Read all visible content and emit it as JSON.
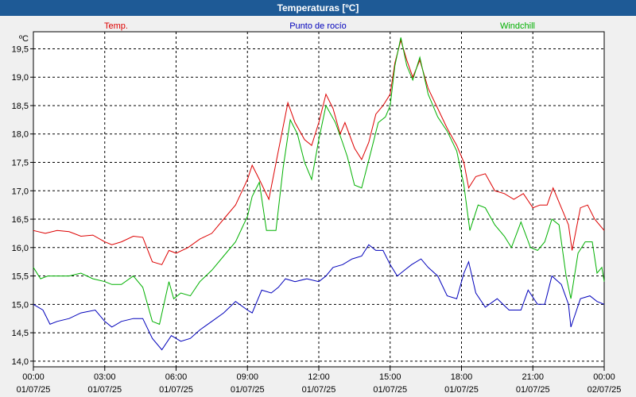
{
  "window": {
    "title": "Temperaturas [ºC]"
  },
  "colors": {
    "temp": "#dd0000",
    "dew": "#0000bb",
    "windchill": "#00b000",
    "titlebar": "#1e5a96"
  },
  "chart_data": {
    "type": "line",
    "title": "Temperaturas [ºC]",
    "ylabel": "ºC",
    "ylim": [
      13.9,
      19.8
    ],
    "yticks": [
      "14,0",
      "14,5",
      "15,0",
      "15,5",
      "16,0",
      "16,5",
      "17,0",
      "17,5",
      "18,0",
      "18,5",
      "19,0",
      "19,5"
    ],
    "xlim_hours": [
      0,
      24
    ],
    "xticks": [
      {
        "time": "00:00",
        "date": "01/07/25"
      },
      {
        "time": "03:00",
        "date": "01/07/25"
      },
      {
        "time": "06:00",
        "date": "01/07/25"
      },
      {
        "time": "09:00",
        "date": "01/07/25"
      },
      {
        "time": "12:00",
        "date": "01/07/25"
      },
      {
        "time": "15:00",
        "date": "01/07/25"
      },
      {
        "time": "18:00",
        "date": "01/07/25"
      },
      {
        "time": "21:00",
        "date": "01/07/25"
      },
      {
        "time": "00:00",
        "date": "02/07/25"
      }
    ],
    "grid": true,
    "legend_position": "top",
    "series": [
      {
        "name": "Temp.",
        "color": "#dd0000",
        "points": [
          [
            0,
            16.3
          ],
          [
            0.5,
            16.25
          ],
          [
            1,
            16.3
          ],
          [
            1.5,
            16.28
          ],
          [
            2,
            16.2
          ],
          [
            2.5,
            16.22
          ],
          [
            3,
            16.1
          ],
          [
            3.3,
            16.05
          ],
          [
            3.7,
            16.1
          ],
          [
            4.2,
            16.2
          ],
          [
            4.6,
            16.18
          ],
          [
            5,
            15.75
          ],
          [
            5.4,
            15.7
          ],
          [
            5.7,
            15.95
          ],
          [
            6,
            15.9
          ],
          [
            6.5,
            16.0
          ],
          [
            7,
            16.15
          ],
          [
            7.5,
            16.25
          ],
          [
            8,
            16.5
          ],
          [
            8.5,
            16.75
          ],
          [
            9,
            17.2
          ],
          [
            9.2,
            17.45
          ],
          [
            9.5,
            17.2
          ],
          [
            9.9,
            16.85
          ],
          [
            10.3,
            17.7
          ],
          [
            10.7,
            18.55
          ],
          [
            11,
            18.2
          ],
          [
            11.4,
            17.9
          ],
          [
            11.7,
            17.8
          ],
          [
            12,
            18.2
          ],
          [
            12.3,
            18.7
          ],
          [
            12.6,
            18.45
          ],
          [
            12.9,
            18.0
          ],
          [
            13.1,
            18.2
          ],
          [
            13.5,
            17.75
          ],
          [
            13.8,
            17.55
          ],
          [
            14.1,
            17.85
          ],
          [
            14.4,
            18.35
          ],
          [
            14.7,
            18.5
          ],
          [
            15.0,
            18.7
          ],
          [
            15.2,
            19.25
          ],
          [
            15.45,
            19.65
          ],
          [
            15.7,
            19.3
          ],
          [
            15.95,
            19.0
          ],
          [
            16.25,
            19.3
          ],
          [
            16.6,
            18.8
          ],
          [
            17,
            18.45
          ],
          [
            17.4,
            18.1
          ],
          [
            17.8,
            17.8
          ],
          [
            18.1,
            17.5
          ],
          [
            18.3,
            17.05
          ],
          [
            18.6,
            17.25
          ],
          [
            19,
            17.3
          ],
          [
            19.4,
            17.0
          ],
          [
            19.8,
            16.95
          ],
          [
            20.2,
            16.85
          ],
          [
            20.6,
            16.95
          ],
          [
            21,
            16.7
          ],
          [
            21.3,
            16.75
          ],
          [
            21.6,
            16.75
          ],
          [
            21.85,
            17.05
          ],
          [
            22.2,
            16.7
          ],
          [
            22.5,
            16.4
          ],
          [
            22.65,
            15.95
          ],
          [
            23,
            16.7
          ],
          [
            23.3,
            16.75
          ],
          [
            23.6,
            16.5
          ],
          [
            24,
            16.3
          ]
        ]
      },
      {
        "name": "Punto de rocío",
        "color": "#0000bb",
        "points": [
          [
            0,
            15.0
          ],
          [
            0.4,
            14.9
          ],
          [
            0.7,
            14.65
          ],
          [
            1,
            14.7
          ],
          [
            1.5,
            14.75
          ],
          [
            2,
            14.85
          ],
          [
            2.6,
            14.9
          ],
          [
            3,
            14.7
          ],
          [
            3.3,
            14.6
          ],
          [
            3.7,
            14.7
          ],
          [
            4.2,
            14.75
          ],
          [
            4.6,
            14.75
          ],
          [
            5.0,
            14.4
          ],
          [
            5.4,
            14.2
          ],
          [
            5.8,
            14.45
          ],
          [
            6.2,
            14.35
          ],
          [
            6.6,
            14.4
          ],
          [
            7,
            14.55
          ],
          [
            7.5,
            14.7
          ],
          [
            8,
            14.85
          ],
          [
            8.5,
            15.05
          ],
          [
            9,
            14.9
          ],
          [
            9.2,
            14.85
          ],
          [
            9.6,
            15.25
          ],
          [
            10,
            15.2
          ],
          [
            10.3,
            15.3
          ],
          [
            10.6,
            15.45
          ],
          [
            11,
            15.4
          ],
          [
            11.5,
            15.45
          ],
          [
            12,
            15.4
          ],
          [
            12.3,
            15.5
          ],
          [
            12.6,
            15.65
          ],
          [
            13,
            15.7
          ],
          [
            13.4,
            15.8
          ],
          [
            13.8,
            15.85
          ],
          [
            14.1,
            16.05
          ],
          [
            14.4,
            15.95
          ],
          [
            14.7,
            15.95
          ],
          [
            15.0,
            15.7
          ],
          [
            15.3,
            15.5
          ],
          [
            15.6,
            15.6
          ],
          [
            15.9,
            15.7
          ],
          [
            16.3,
            15.8
          ],
          [
            16.6,
            15.65
          ],
          [
            17,
            15.5
          ],
          [
            17.4,
            15.15
          ],
          [
            17.8,
            15.1
          ],
          [
            18.1,
            15.55
          ],
          [
            18.3,
            15.75
          ],
          [
            18.6,
            15.2
          ],
          [
            19,
            14.95
          ],
          [
            19.5,
            15.1
          ],
          [
            20,
            14.9
          ],
          [
            20.5,
            14.9
          ],
          [
            20.8,
            15.25
          ],
          [
            21.2,
            15.0
          ],
          [
            21.5,
            15.0
          ],
          [
            21.8,
            15.5
          ],
          [
            22.2,
            15.35
          ],
          [
            22.5,
            15.0
          ],
          [
            22.6,
            14.6
          ],
          [
            23,
            15.1
          ],
          [
            23.4,
            15.15
          ],
          [
            23.7,
            15.05
          ],
          [
            24,
            15.0
          ]
        ]
      },
      {
        "name": "Windchill",
        "color": "#00b000",
        "points": [
          [
            0,
            15.65
          ],
          [
            0.3,
            15.45
          ],
          [
            0.6,
            15.5
          ],
          [
            1,
            15.5
          ],
          [
            1.5,
            15.5
          ],
          [
            2,
            15.55
          ],
          [
            2.5,
            15.45
          ],
          [
            3,
            15.4
          ],
          [
            3.3,
            15.35
          ],
          [
            3.7,
            15.35
          ],
          [
            4.2,
            15.5
          ],
          [
            4.6,
            15.3
          ],
          [
            5,
            14.7
          ],
          [
            5.3,
            14.65
          ],
          [
            5.7,
            15.4
          ],
          [
            5.9,
            15.1
          ],
          [
            6.2,
            15.2
          ],
          [
            6.6,
            15.15
          ],
          [
            7,
            15.4
          ],
          [
            7.5,
            15.6
          ],
          [
            8,
            15.85
          ],
          [
            8.5,
            16.1
          ],
          [
            9,
            16.55
          ],
          [
            9.2,
            16.9
          ],
          [
            9.5,
            17.15
          ],
          [
            9.8,
            16.3
          ],
          [
            10.2,
            16.3
          ],
          [
            10.5,
            17.4
          ],
          [
            10.8,
            18.25
          ],
          [
            11.1,
            18.0
          ],
          [
            11.4,
            17.5
          ],
          [
            11.7,
            17.2
          ],
          [
            12.0,
            17.9
          ],
          [
            12.3,
            18.5
          ],
          [
            12.7,
            18.2
          ],
          [
            13.0,
            17.85
          ],
          [
            13.2,
            17.6
          ],
          [
            13.5,
            17.1
          ],
          [
            13.8,
            17.05
          ],
          [
            14.2,
            17.7
          ],
          [
            14.5,
            18.2
          ],
          [
            14.8,
            18.3
          ],
          [
            15.0,
            18.5
          ],
          [
            15.2,
            19.2
          ],
          [
            15.45,
            19.7
          ],
          [
            15.7,
            19.2
          ],
          [
            15.95,
            18.95
          ],
          [
            16.25,
            19.35
          ],
          [
            16.6,
            18.7
          ],
          [
            17,
            18.3
          ],
          [
            17.4,
            18.05
          ],
          [
            17.8,
            17.7
          ],
          [
            18.1,
            17.1
          ],
          [
            18.35,
            16.3
          ],
          [
            18.7,
            16.75
          ],
          [
            19,
            16.7
          ],
          [
            19.4,
            16.4
          ],
          [
            19.8,
            16.2
          ],
          [
            20.1,
            16.0
          ],
          [
            20.5,
            16.45
          ],
          [
            20.9,
            16.0
          ],
          [
            21.2,
            15.95
          ],
          [
            21.5,
            16.1
          ],
          [
            21.8,
            16.5
          ],
          [
            22.1,
            16.4
          ],
          [
            22.4,
            15.5
          ],
          [
            22.6,
            15.1
          ],
          [
            22.9,
            15.9
          ],
          [
            23.2,
            16.1
          ],
          [
            23.5,
            16.1
          ],
          [
            23.7,
            15.55
          ],
          [
            23.9,
            15.65
          ],
          [
            24,
            15.4
          ]
        ]
      }
    ]
  }
}
